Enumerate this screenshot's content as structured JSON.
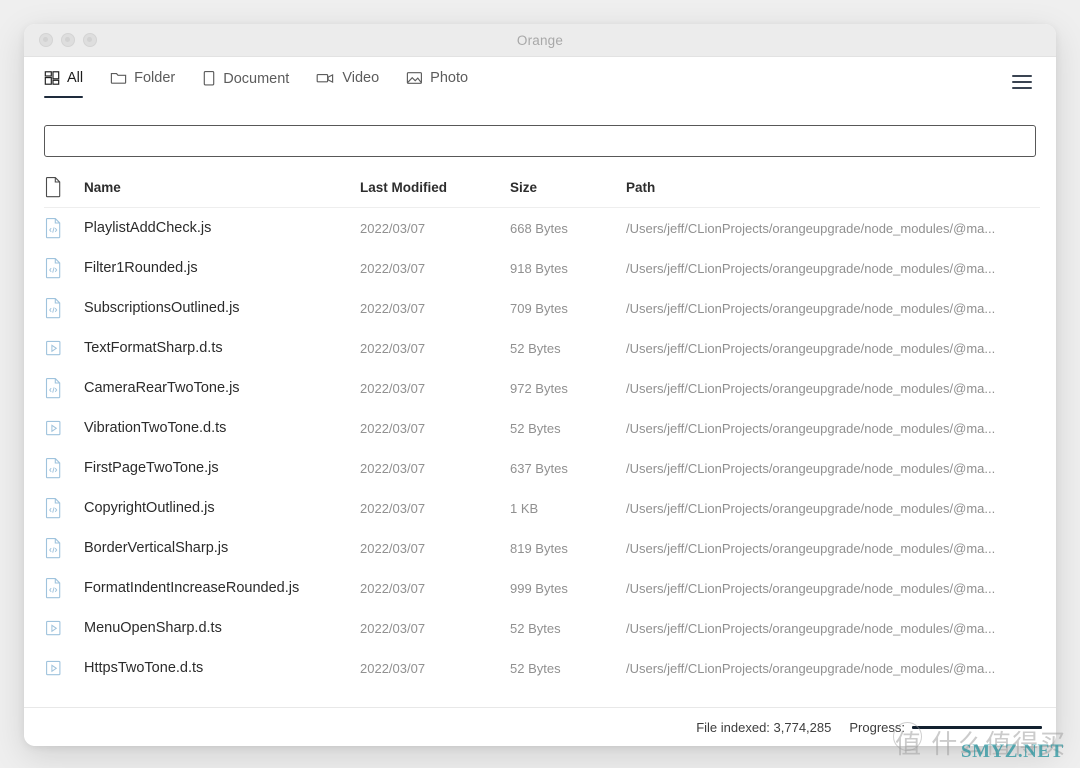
{
  "window": {
    "title": "Orange",
    "traffic_lights": [
      "close",
      "minimize",
      "maximize"
    ]
  },
  "tabs": [
    {
      "label": "All",
      "icon": "grid-icon",
      "active": true
    },
    {
      "label": "Folder",
      "icon": "folder-icon",
      "active": false
    },
    {
      "label": "Document",
      "icon": "document-icon",
      "active": false
    },
    {
      "label": "Video",
      "icon": "video-icon",
      "active": false
    },
    {
      "label": "Photo",
      "icon": "photo-icon",
      "active": false
    }
  ],
  "menu": {
    "icon": "hamburger-menu-icon"
  },
  "search": {
    "value": "",
    "placeholder": ""
  },
  "table": {
    "headers": {
      "icon": "file-icon",
      "name": "Name",
      "modified": "Last Modified",
      "size": "Size",
      "path": "Path"
    },
    "rows": [
      {
        "icon": "js-file-icon",
        "name": "PlaylistAddCheck.js",
        "modified": "2022/03/07",
        "size": "668 Bytes",
        "path": "/Users/jeff/CLionProjects/orangeupgrade/node_modules/@ma..."
      },
      {
        "icon": "js-file-icon",
        "name": "Filter1Rounded.js",
        "modified": "2022/03/07",
        "size": "918 Bytes",
        "path": "/Users/jeff/CLionProjects/orangeupgrade/node_modules/@ma..."
      },
      {
        "icon": "js-file-icon",
        "name": "SubscriptionsOutlined.js",
        "modified": "2022/03/07",
        "size": "709 Bytes",
        "path": "/Users/jeff/CLionProjects/orangeupgrade/node_modules/@ma..."
      },
      {
        "icon": "dts-file-icon",
        "name": "TextFormatSharp.d.ts",
        "modified": "2022/03/07",
        "size": "52 Bytes",
        "path": "/Users/jeff/CLionProjects/orangeupgrade/node_modules/@ma..."
      },
      {
        "icon": "js-file-icon",
        "name": "CameraRearTwoTone.js",
        "modified": "2022/03/07",
        "size": "972 Bytes",
        "path": "/Users/jeff/CLionProjects/orangeupgrade/node_modules/@ma..."
      },
      {
        "icon": "dts-file-icon",
        "name": "VibrationTwoTone.d.ts",
        "modified": "2022/03/07",
        "size": "52 Bytes",
        "path": "/Users/jeff/CLionProjects/orangeupgrade/node_modules/@ma..."
      },
      {
        "icon": "js-file-icon",
        "name": "FirstPageTwoTone.js",
        "modified": "2022/03/07",
        "size": "637 Bytes",
        "path": "/Users/jeff/CLionProjects/orangeupgrade/node_modules/@ma..."
      },
      {
        "icon": "js-file-icon",
        "name": "CopyrightOutlined.js",
        "modified": "2022/03/07",
        "size": "1 KB",
        "path": "/Users/jeff/CLionProjects/orangeupgrade/node_modules/@ma..."
      },
      {
        "icon": "js-file-icon",
        "name": "BorderVerticalSharp.js",
        "modified": "2022/03/07",
        "size": "819 Bytes",
        "path": "/Users/jeff/CLionProjects/orangeupgrade/node_modules/@ma..."
      },
      {
        "icon": "js-file-icon",
        "name": "FormatIndentIncreaseRounded.js",
        "modified": "2022/03/07",
        "size": "999 Bytes",
        "path": "/Users/jeff/CLionProjects/orangeupgrade/node_modules/@ma..."
      },
      {
        "icon": "dts-file-icon",
        "name": "MenuOpenSharp.d.ts",
        "modified": "2022/03/07",
        "size": "52 Bytes",
        "path": "/Users/jeff/CLionProjects/orangeupgrade/node_modules/@ma..."
      },
      {
        "icon": "dts-file-icon",
        "name": "HttpsTwoTone.d.ts",
        "modified": "2022/03/07",
        "size": "52 Bytes",
        "path": "/Users/jeff/CLionProjects/orangeupgrade/node_modules/@ma..."
      }
    ]
  },
  "statusbar": {
    "file_indexed": "File indexed: 3,774,285",
    "progress_label": "Progress:",
    "progress_percent": 100
  },
  "watermark": {
    "cjk": "值 什么值得买",
    "site": "SMYZ.NET"
  },
  "colors": {
    "accent": "#1e2b3c",
    "window_bg": "#ffffff",
    "titlebar_bg": "#ececec",
    "page_bg": "#efefef",
    "muted_text": "#909090"
  }
}
